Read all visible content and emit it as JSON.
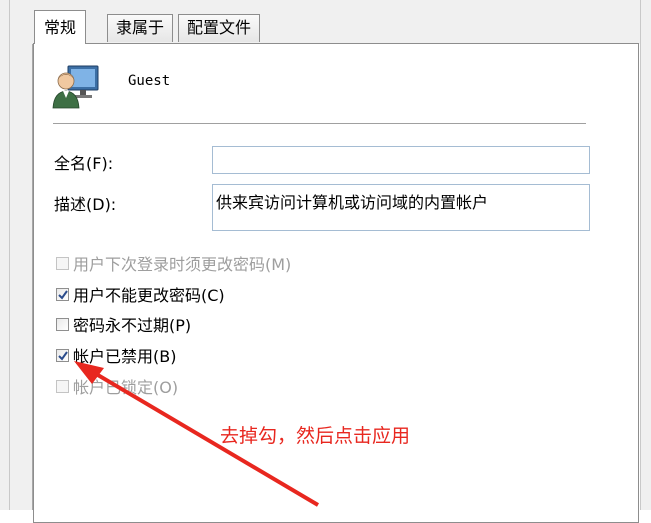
{
  "tabs": [
    {
      "label": "常规",
      "active": true
    },
    {
      "label": "隶属于",
      "active": false
    },
    {
      "label": "配置文件",
      "active": false
    }
  ],
  "user": {
    "name": "Guest",
    "icon": "user-computer-icon"
  },
  "fields": {
    "fullname_label": "全名(F):",
    "fullname_value": "",
    "description_label": "描述(D):",
    "description_value": "供来宾访问计算机或访问域的内置帐户"
  },
  "checkboxes": [
    {
      "label": "用户下次登录时须更改密码(M)",
      "checked": false,
      "enabled": false
    },
    {
      "label": "用户不能更改密码(C)",
      "checked": true,
      "enabled": true
    },
    {
      "label": "密码永不过期(P)",
      "checked": false,
      "enabled": true
    },
    {
      "label": "帐户已禁用(B)",
      "checked": true,
      "enabled": true
    },
    {
      "label": "帐户已锁定(O)",
      "checked": false,
      "enabled": false
    }
  ],
  "annotation": {
    "text": "去掉勾，然后点击应用",
    "color": "#e8271f"
  }
}
